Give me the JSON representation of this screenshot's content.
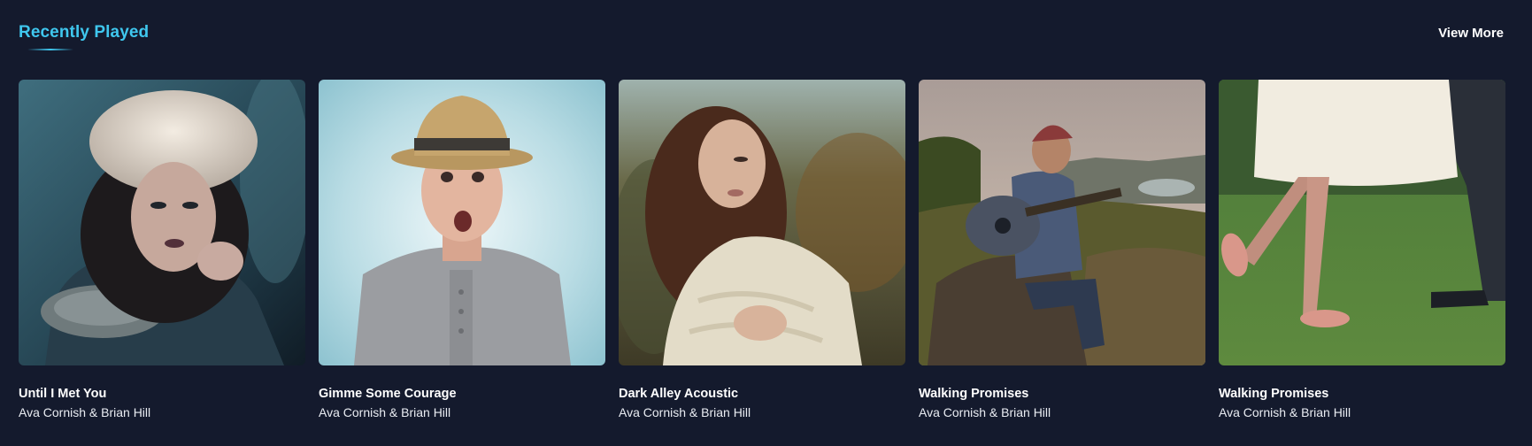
{
  "section": {
    "title": "Recently Played",
    "view_more_label": "View More"
  },
  "colors": {
    "background": "#141a2d",
    "accent": "#3fc7ee",
    "text": "#ffffff"
  },
  "tracks": [
    {
      "title": "Until I Met You",
      "artist": "Ava Cornish & Brian Hill",
      "image": "woman-in-fur-hood-photo"
    },
    {
      "title": "Gimme Some Courage",
      "artist": "Ava Cornish & Brian Hill",
      "image": "surprised-man-in-hat-photo"
    },
    {
      "title": "Dark Alley Acoustic",
      "artist": "Ava Cornish & Brian Hill",
      "image": "woman-in-shawl-photo"
    },
    {
      "title": "Walking Promises",
      "artist": "Ava Cornish & Brian Hill",
      "image": "man-playing-guitar-photo"
    },
    {
      "title": "Walking Promises",
      "artist": "Ava Cornish & Brian Hill",
      "image": "couple-on-grass-photo"
    }
  ]
}
